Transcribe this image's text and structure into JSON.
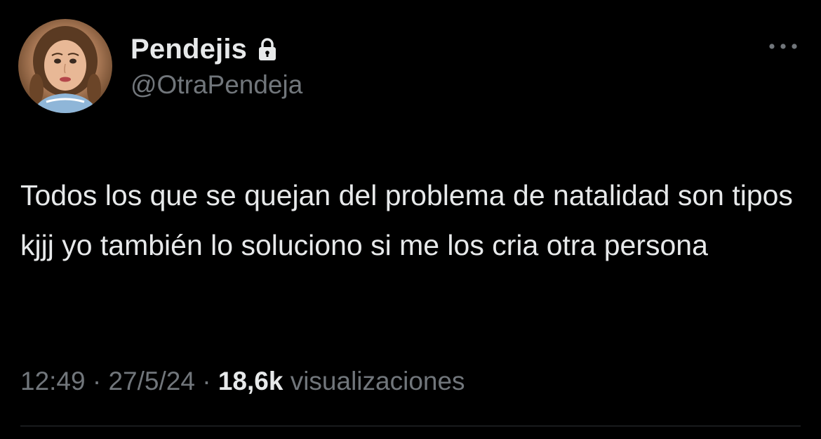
{
  "author": {
    "display_name": "Pendejis",
    "handle": "@OtraPendeja",
    "protected_icon": "lock-icon",
    "avatar_icon": "profile-photo"
  },
  "tweet": {
    "text": "Todos los que se quejan del problema de natalidad son tipos kjjj yo también lo soluciono si me los cria otra persona",
    "time": "12:49",
    "separator": "·",
    "date": "27/5/24",
    "views_count": "18,6k",
    "views_label": "visualizaciones"
  },
  "menu": {
    "more_icon": "more-options-icon"
  },
  "colors": {
    "background": "#000000",
    "primary_text": "#e7e9ea",
    "secondary_text": "#71767b",
    "divider": "#2f3336"
  }
}
